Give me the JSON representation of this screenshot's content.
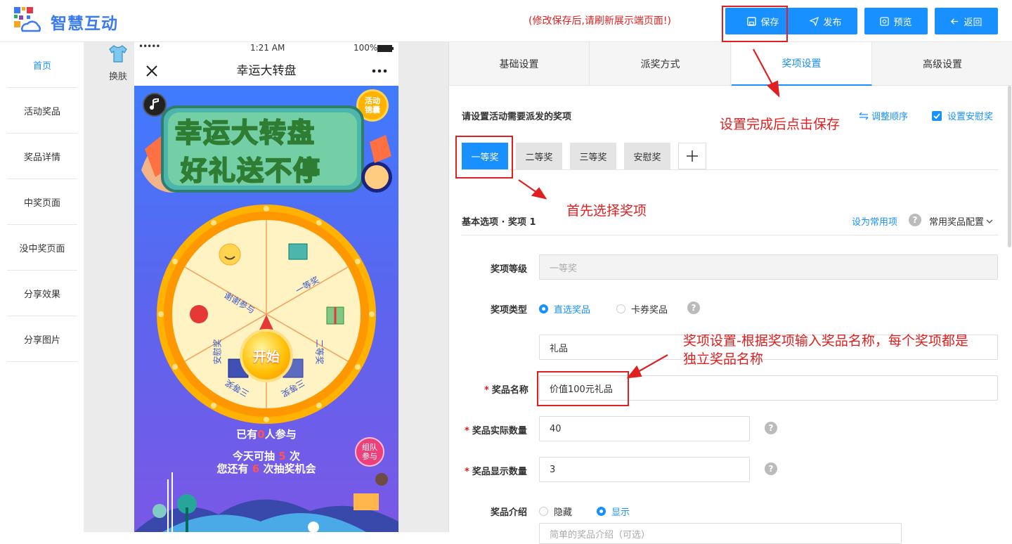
{
  "header": {
    "logo_text": "智慧互动",
    "notice": "(修改保存后,请刷新展示端页面!)",
    "buttons": {
      "save": "保存",
      "publish": "发布",
      "preview": "预览",
      "back": "返回"
    }
  },
  "sidebar": {
    "items": [
      {
        "label": "首页",
        "active": true
      },
      {
        "label": "活动奖品"
      },
      {
        "label": "奖品详情"
      },
      {
        "label": "中奖页面"
      },
      {
        "label": "没中奖页面"
      },
      {
        "label": "分享效果"
      },
      {
        "label": "分享图片"
      }
    ]
  },
  "preview": {
    "skin_label": "换肤",
    "status": {
      "signal": "•••••",
      "time": "1:21 AM",
      "battery": "100%"
    },
    "nav_title": "幸运大转盘",
    "banner_line1": "幸运大转盘",
    "banner_line2": "好礼送不停",
    "pouch_badge": "活动锦囊",
    "team_badge": "组队参与",
    "wheel": {
      "start": "开始",
      "segments": [
        "一等奖",
        "二等奖",
        "三等奖",
        "三等奖",
        "安慰奖",
        "谢谢参与"
      ]
    },
    "participants": {
      "prefix": "已有",
      "count": "0",
      "suffix": "人参与"
    },
    "draw_today": {
      "prefix": "今天可抽",
      "count": "5",
      "suffix": "次"
    },
    "draw_left": {
      "prefix": "您还有",
      "count": "6",
      "suffix": "次抽奖机会"
    }
  },
  "settings": {
    "tabs": [
      "基础设置",
      "派奖方式",
      "奖项设置",
      "高级设置"
    ],
    "active_tab": "奖项设置",
    "section_title": "请设置活动需要派发的奖项",
    "adjust_order": "调整顺序",
    "consolation_checkbox": "设置安慰奖",
    "prize_tabs": [
      "一等奖",
      "二等奖",
      "三等奖",
      "安慰奖"
    ],
    "add_tab": "+",
    "basic_title": "基本选项 · 奖项 1",
    "set_common": "设为常用项",
    "common_config": "常用奖品配置",
    "fields": {
      "level_label": "奖项等级",
      "level_value": "一等奖",
      "type_label": "奖项类型",
      "type_options": [
        "直选奖品",
        "卡券奖品"
      ],
      "gift_value": "礼品",
      "name_label": "奖品名称",
      "name_value": "价值100元礼品",
      "actual_qty_label": "奖品实际数量",
      "actual_qty_value": "40",
      "display_qty_label": "奖品显示数量",
      "display_qty_value": "3",
      "intro_label": "奖品介绍",
      "intro_options": [
        "隐藏",
        "显示"
      ],
      "intro_placeholder": "简单的奖品介绍（可选）"
    }
  },
  "annotations": {
    "save_hint": "设置完成后点击保存",
    "select_hint": "首先选择奖项",
    "name_hint_line1": "奖项设置-根据奖项输入奖品名称，每个奖项都是",
    "name_hint_line2": "独立奖品名称"
  },
  "colors": {
    "primary": "#1890ff",
    "annotation_red": "#e02020",
    "logo_blue": "#3a7bf0"
  }
}
